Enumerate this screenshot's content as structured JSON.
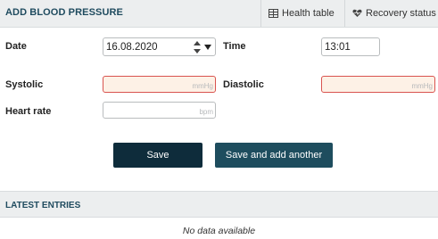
{
  "header": {
    "title": "ADD BLOOD PRESSURE",
    "health_table_label": "Health table",
    "recovery_status_label": "Recovery status"
  },
  "form": {
    "date": {
      "label": "Date",
      "value": "16.08.2020"
    },
    "time": {
      "label": "Time",
      "value": "13:01"
    },
    "systolic": {
      "label": "Systolic",
      "unit": "mmHg"
    },
    "diastolic": {
      "label": "Diastolic",
      "unit": "mmHg"
    },
    "heart_rate": {
      "label": "Heart rate",
      "unit": "bpm"
    }
  },
  "actions": {
    "save_label": "Save",
    "save_add_label": "Save and add another"
  },
  "latest": {
    "title": "LATEST ENTRIES",
    "empty_text": "No data available"
  },
  "colors": {
    "header_bg": "#eceeef",
    "title_color": "#1f4b5f",
    "save_button": "#0e2c3b",
    "save_add_button": "#1e4d5e",
    "invalid_border": "#d9534f",
    "invalid_bg": "#fdf1e6"
  }
}
